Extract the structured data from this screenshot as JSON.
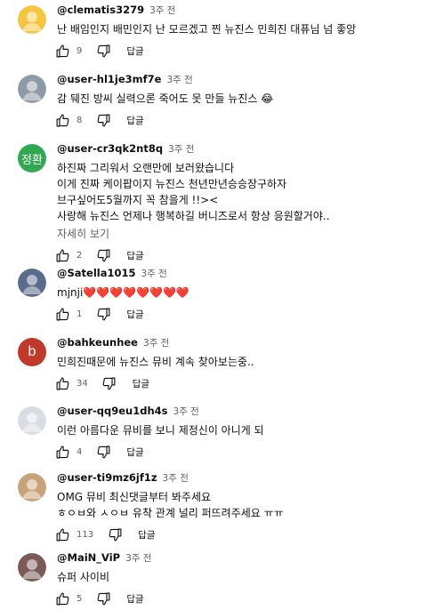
{
  "comments": [
    {
      "author": "@clematis3279",
      "time": "3주 전",
      "lines": [
        "난 배임인지 배민인지 난 모르겠고  찐 뉴진스 민희진 대퓨님  넘 좋앙"
      ],
      "likes": "9",
      "reply": "답글",
      "avatar": {
        "type": "image",
        "color": "#f5c542"
      }
    },
    {
      "author": "@user-hl1je3mf7e",
      "time": "3주 전",
      "lines": [
        "감 뒈진 방씨 실력으론 죽어도 못 만들 뉴진스 😂"
      ],
      "likes": "8",
      "reply": "답글",
      "avatar": {
        "type": "image",
        "color": "#8e9aa8"
      }
    },
    {
      "author": "@user-cr3qk2nt8q",
      "time": "3주 전",
      "lines": [
        "하진짜 그리워서 오랜만에 보러왔습니다",
        "이게 진짜 케이팝이지 뉴진스 천년만년승승장구하자",
        "브구싶어도5월까지 꼭 참을게 !!><",
        "사랑해 뉴진스  언제나 행복하길 버니즈로서 항상 응원할거야.."
      ],
      "more": "자세히 보기",
      "likes": "2",
      "reply": "답글",
      "avatar": {
        "type": "letter",
        "text": "정환",
        "color": "#33a852"
      }
    },
    {
      "author": "@Satella1015",
      "time": "3주 전",
      "lines": [
        "mjnji❤️❤️❤️❤️❤️❤️❤️❤️"
      ],
      "likes": "1",
      "reply": "답글",
      "avatar": {
        "type": "image",
        "color": "#5a6b8c"
      }
    },
    {
      "author": "@bahkeunhee",
      "time": "3주 전",
      "lines": [
        "민희진때문에 뉴진스 뮤비 계속 찾아보는중.."
      ],
      "likes": "34",
      "reply": "답글",
      "avatar": {
        "type": "letter",
        "text": "b",
        "color": "#c0392b"
      }
    },
    {
      "author": "@user-qq9eu1dh4s",
      "time": "3주 전",
      "lines": [
        "이런 아름다운 뮤비를 보니 제정신이 아니게 되"
      ],
      "likes": "4",
      "reply": "답글",
      "avatar": {
        "type": "image",
        "color": "#d9dde3"
      }
    },
    {
      "author": "@user-ti9mz6jf1z",
      "time": "3주 전",
      "lines": [
        "OMG 뮤비 최신댓글부터 봐주세요",
        "ㅎㅇㅂ와 ㅅㅇㅂ 유착 관계 널리 퍼뜨려주세요 ㅠㅠ"
      ],
      "likes": "113",
      "reply": "답글",
      "avatar": {
        "type": "image",
        "color": "#c8a27a"
      }
    },
    {
      "author": "@MaiN_ViP",
      "time": "3주 전",
      "lines": [
        "슈퍼 사이비"
      ],
      "likes": "5",
      "reply": "답글",
      "avatar": {
        "type": "image",
        "color": "#7d5a5a"
      }
    }
  ]
}
